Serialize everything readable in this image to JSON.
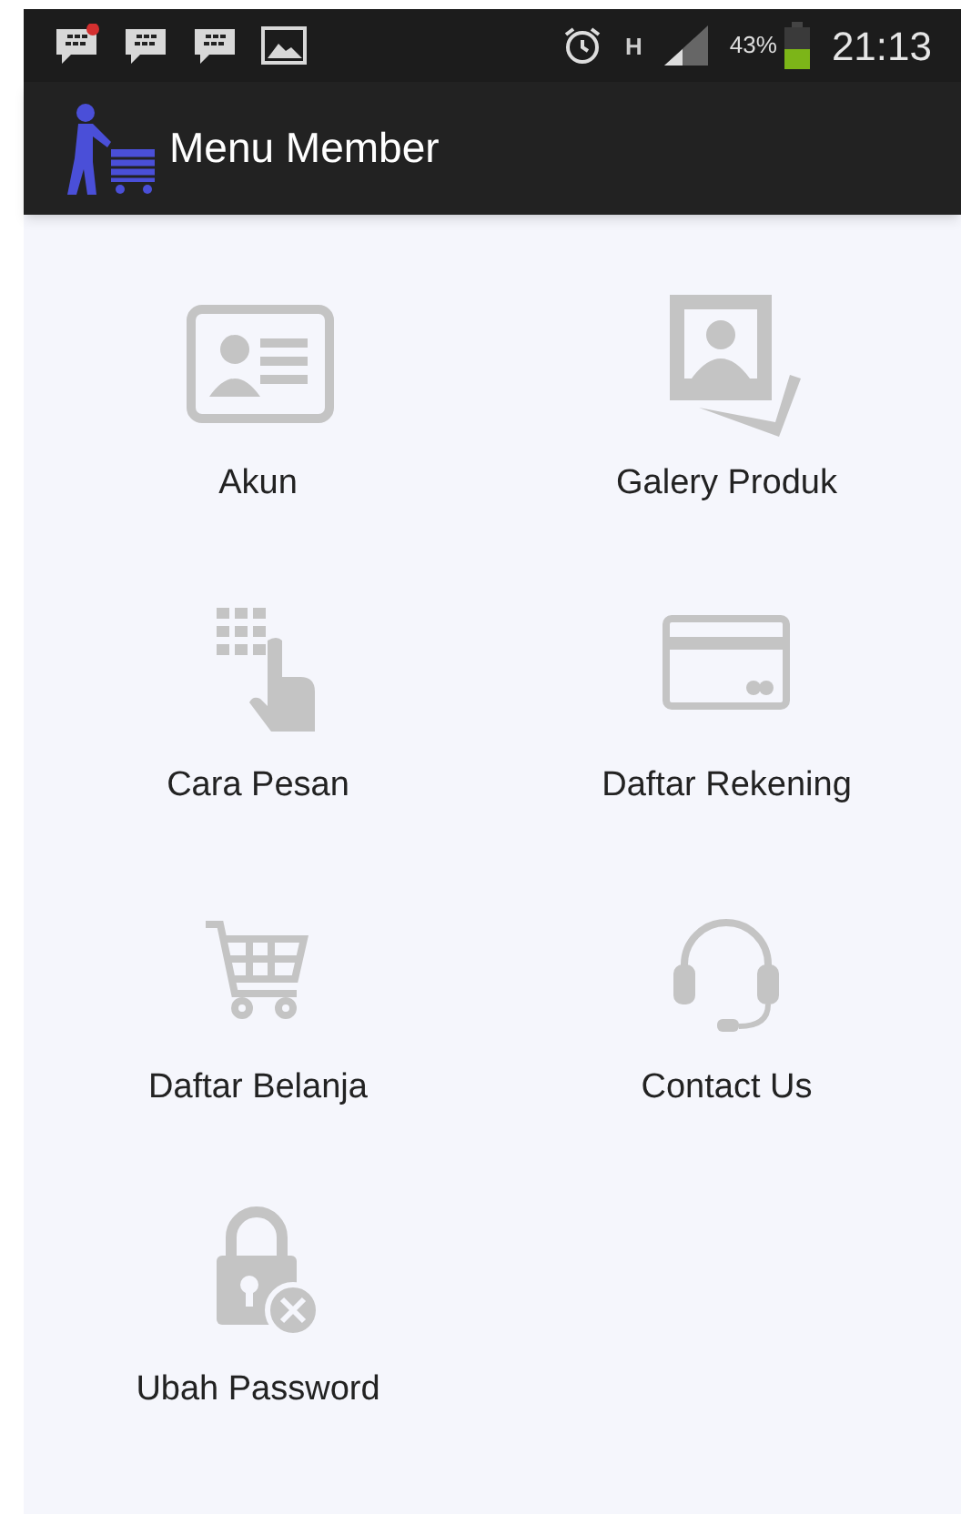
{
  "status_bar": {
    "notifications": [
      {
        "kind": "chat",
        "badge": true
      },
      {
        "kind": "chat",
        "badge": false
      },
      {
        "kind": "chat",
        "badge": false
      },
      {
        "kind": "image",
        "badge": false
      }
    ],
    "network_type": "H",
    "battery": "43%",
    "time": "21:13"
  },
  "app_bar": {
    "title": "Menu Member"
  },
  "menu": [
    {
      "label": "Akun",
      "kind": "id-card"
    },
    {
      "label": "Galery Produk",
      "kind": "photos"
    },
    {
      "label": "Cara Pesan",
      "kind": "keypad"
    },
    {
      "label": "Daftar Rekening",
      "kind": "card"
    },
    {
      "label": "Daftar Belanja",
      "kind": "cart"
    },
    {
      "label": "Contact Us",
      "kind": "headset"
    },
    {
      "label": "Ubah Password",
      "kind": "lock"
    }
  ]
}
